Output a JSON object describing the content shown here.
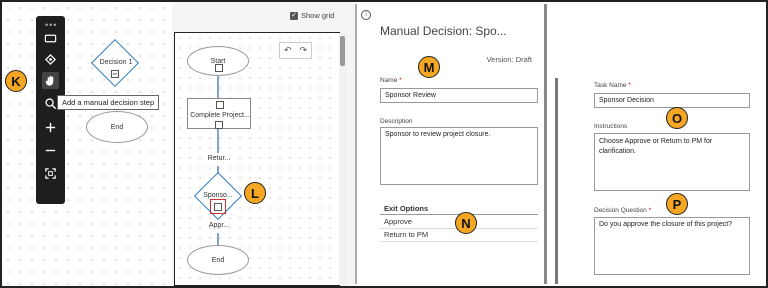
{
  "badges": {
    "k": "K",
    "l": "L",
    "m": "M",
    "n": "N",
    "o": "O",
    "p": "P"
  },
  "panel1": {
    "tooltip": "Add a manual decision step",
    "decision_node": "Decision 1",
    "end_node": "End",
    "toolbar_icons": [
      "rectangle-icon",
      "decision-icon",
      "hand-icon",
      "zoom-icon",
      "plus-icon",
      "minus-icon",
      "fit-icon"
    ]
  },
  "panel2": {
    "show_grid": "Show grid",
    "start": "Start",
    "task": "Complete Project...",
    "return": "Retur...",
    "sponsor": "Sponso...",
    "approve": "Appr...",
    "end": "End"
  },
  "panel3": {
    "title": "Manual Decision: Spo...",
    "version": "Version: Draft",
    "name_label": "Name",
    "name_value": "Sponsor Review",
    "desc_label": "Description",
    "desc_value": "Sponsor to review project closure.",
    "exit_title": "Exit Options",
    "exit_options": [
      "Approve",
      "Return to PM"
    ]
  },
  "panel4": {
    "task_name_label": "Task Name",
    "task_name_value": "Sponsor Decision",
    "instructions_label": "Instructions",
    "instructions_value": "Choose Approve or Return to PM for clarification.",
    "question_label": "Decision Question",
    "question_value": "Do you approve the closure of this project?"
  },
  "colors": {
    "badge": "#f5a623",
    "accent": "#2a7cbf",
    "highlight": "#d32f2f"
  }
}
